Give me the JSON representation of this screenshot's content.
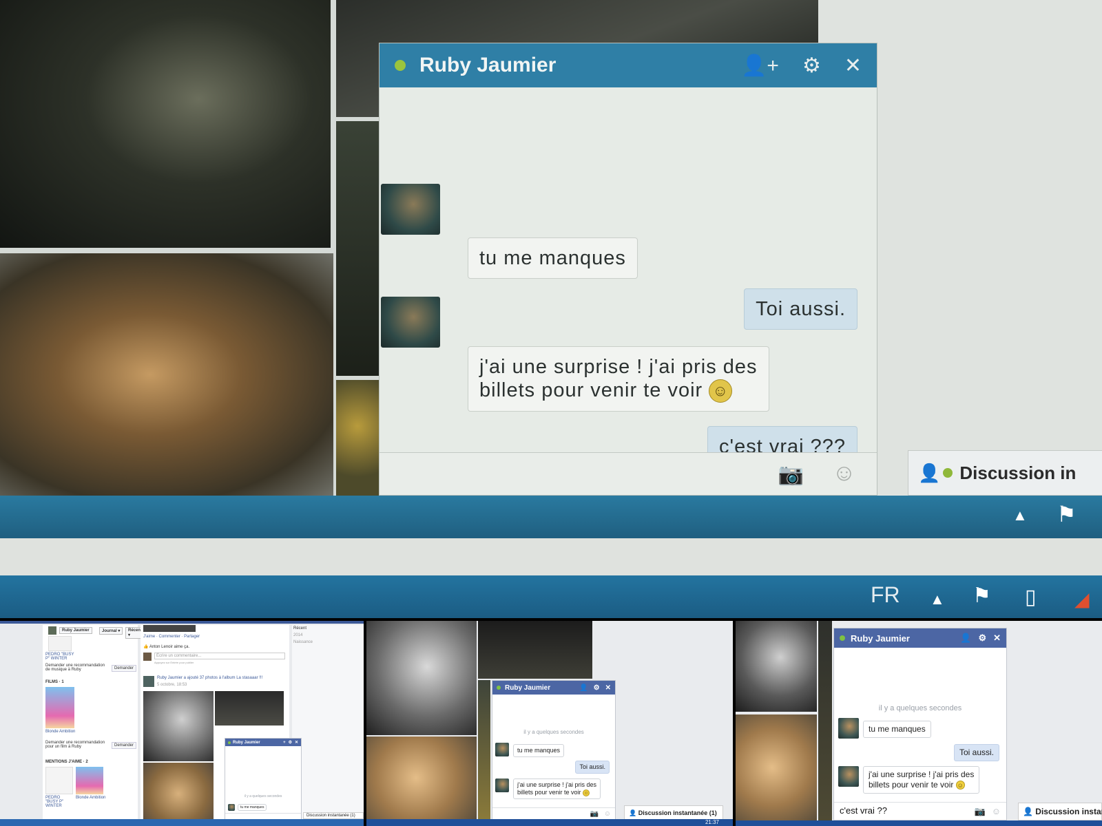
{
  "top": {
    "chat": {
      "title": "Ruby Jaumier",
      "messages": [
        {
          "from": "Ruby Jaumier",
          "text": "tu me manques"
        },
        {
          "from": "me",
          "text": "Toi aussi."
        },
        {
          "from": "Ruby Jaumier",
          "text_line1": "j'ai une surprise ! j'ai pris des",
          "text_line2": "billets pour venir te voir"
        },
        {
          "from": "me",
          "text": "c'est vrai ???"
        }
      ]
    },
    "dock_label": "Discussion in",
    "taskbar": {
      "language": "FR"
    }
  },
  "panel1": {
    "profile_name": "Ruby Jaumier",
    "nav": {
      "journal": "Journal",
      "recent": "Récent"
    },
    "sidebar": {
      "music_person": "PEDRO \"BUSY P\" WINTER",
      "music_request": "Demander une recommandation de musique à Ruby",
      "request_button": "Demander",
      "films_header": "FILMS · 1",
      "film_title": "Blonde Ambition",
      "film_request": "Demander une recommandation pour un film à Ruby",
      "likes_header": "MENTIONS J'AIME · 2",
      "like1": "PEDRO \"BUSY P\" WINTER",
      "like2": "Blonde Ambition"
    },
    "feed": {
      "actions": "J'aime · Commenter · Partager",
      "liker": "Anton Lenoir aime ça.",
      "comment_placeholder": "Écrire un commentaire...",
      "comment_hint": "Appuyez sur Entrée pour publier",
      "post_line": "Ruby Jaumier a ajouté 37 photos à l'album La stasaaar !!!",
      "post_date": "5 octobre, 18:53"
    },
    "timeline": {
      "items": [
        "Récent",
        "2014",
        "Naissance"
      ]
    },
    "chat": {
      "title": "Ruby Jaumier",
      "time": "il y a quelques secondes",
      "message": "tu me manques"
    },
    "dock_label": "Discussion instantanée (1)"
  },
  "panel2": {
    "chat": {
      "title": "Ruby Jaumier",
      "time": "il y a quelques secondes",
      "messages": [
        {
          "from": "Ruby Jaumier",
          "text": "tu me manques"
        },
        {
          "from": "me",
          "text": "Toi aussi."
        },
        {
          "from": "Ruby Jaumier",
          "text_line1": "j'ai une surprise ! j'ai pris des",
          "text_line2": "billets pour venir te voir"
        }
      ]
    },
    "dock_label": "Discussion instantanée (1)",
    "clock": "21:37"
  },
  "panel3": {
    "chat": {
      "title": "Ruby Jaumier",
      "time": "il y a quelques secondes",
      "messages": [
        {
          "from": "Ruby Jaumier",
          "text": "tu me manques"
        },
        {
          "from": "me",
          "text": "Toi aussi."
        },
        {
          "from": "Ruby Jaumier",
          "text_line1": "j'ai une surprise ! j'ai pris des",
          "text_line2": "billets pour venir te voir"
        }
      ],
      "composer_value": "c'est vrai ??"
    },
    "dock_label": "Discussion instan"
  },
  "icons": {
    "add_friend": "add-friend-icon",
    "settings": "gear-icon",
    "close": "close-icon",
    "camera": "camera-icon",
    "emoji": "emoji-icon",
    "flag": "flag-icon"
  },
  "colors": {
    "facebook_blue": "#4c66a4",
    "online": "#7fc241",
    "taskbar": "#2374a0"
  }
}
